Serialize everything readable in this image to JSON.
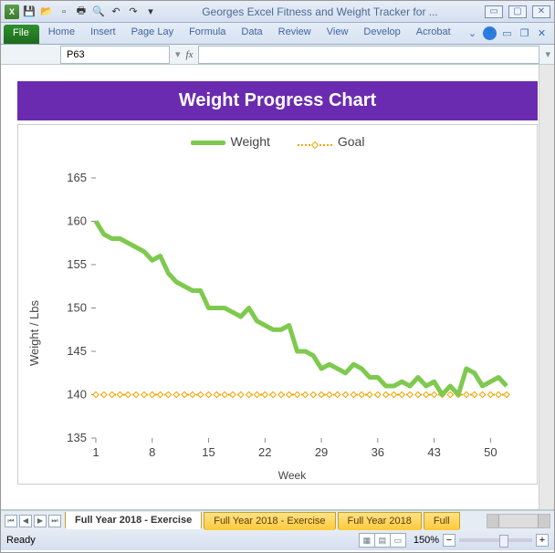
{
  "app_title": "Georges Excel Fitness and Weight Tracker for ...",
  "ribbon_tabs": [
    "File",
    "Home",
    "Insert",
    "Page Lay",
    "Formula",
    "Data",
    "Review",
    "View",
    "Develop",
    "Acrobat"
  ],
  "namebox_value": "P63",
  "fx_label": "fx",
  "chart_title_banner": "Weight Progress Chart",
  "legend": {
    "series1": "Weight",
    "series2": "Goal"
  },
  "xaxis_label": "Week",
  "yaxis_label": "Weight / Lbs",
  "sheet_tabs": [
    "Full Year 2018 - Exercise",
    "Full Year 2018 - Exercise",
    "Full Year 2018",
    "Full"
  ],
  "active_sheet_index": 0,
  "status_text": "Ready",
  "zoom_pct": "150%",
  "chart_data": {
    "type": "line",
    "x": [
      1,
      2,
      3,
      4,
      5,
      6,
      7,
      8,
      9,
      10,
      11,
      12,
      13,
      14,
      15,
      16,
      17,
      18,
      19,
      20,
      21,
      22,
      23,
      24,
      25,
      26,
      27,
      28,
      29,
      30,
      31,
      32,
      33,
      34,
      35,
      36,
      37,
      38,
      39,
      40,
      41,
      42,
      43,
      44,
      45,
      46,
      47,
      48,
      49,
      50,
      51,
      52
    ],
    "series": [
      {
        "name": "Weight",
        "color": "#7fc94f",
        "values": [
          160,
          158.5,
          158,
          158,
          157.5,
          157,
          156.5,
          155.5,
          156,
          154,
          153,
          152.5,
          152,
          152,
          150,
          150,
          150,
          149.5,
          149,
          150,
          148.5,
          148,
          147.5,
          147.5,
          148,
          145,
          145,
          144.5,
          143,
          143.5,
          143,
          142.5,
          143.5,
          143,
          142,
          142,
          141,
          141,
          141.5,
          141,
          142,
          141,
          141.5,
          140,
          141,
          140,
          143,
          142.5,
          141,
          141.5,
          142,
          141
        ]
      },
      {
        "name": "Goal",
        "color": "#f0a500",
        "values": [
          140,
          140,
          140,
          140,
          140,
          140,
          140,
          140,
          140,
          140,
          140,
          140,
          140,
          140,
          140,
          140,
          140,
          140,
          140,
          140,
          140,
          140,
          140,
          140,
          140,
          140,
          140,
          140,
          140,
          140,
          140,
          140,
          140,
          140,
          140,
          140,
          140,
          140,
          140,
          140,
          140,
          140,
          140,
          140,
          140,
          140,
          140,
          140,
          140,
          140,
          140,
          140
        ]
      }
    ],
    "xticks": [
      1,
      8,
      15,
      22,
      29,
      36,
      43,
      50
    ],
    "yticks": [
      135,
      140,
      145,
      150,
      155,
      160,
      165
    ],
    "xlabel": "Week",
    "ylabel": "Weight / Lbs",
    "xlim": [
      1,
      52
    ],
    "ylim": [
      135,
      165
    ]
  }
}
